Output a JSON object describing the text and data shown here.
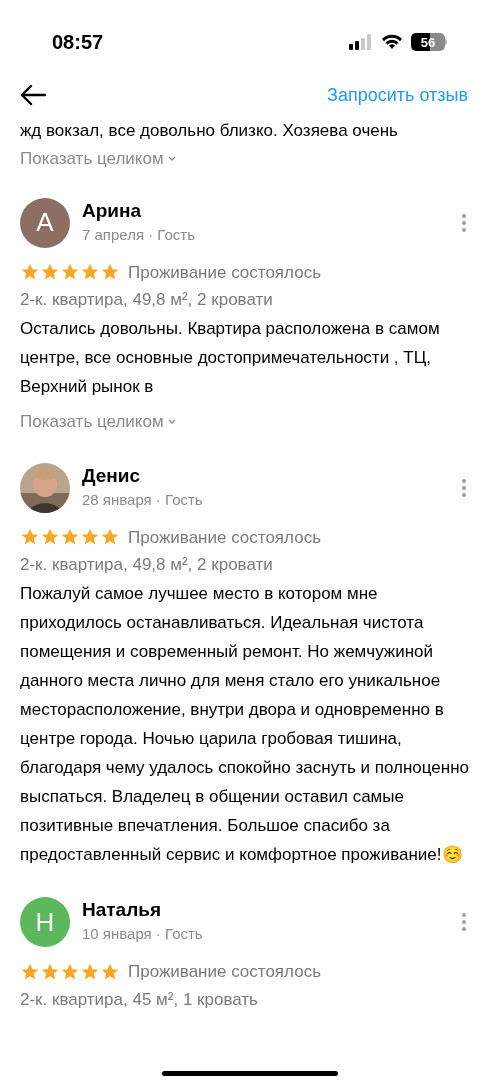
{
  "status_bar": {
    "time": "08:57",
    "battery": "56"
  },
  "header": {
    "action": "Запросить отзыв"
  },
  "previous_review": {
    "text_tail": "жд вокзал, все довольно близко. Хозяева очень",
    "expand": "Показать целиком"
  },
  "reviews": [
    {
      "avatar": {
        "kind": "letter",
        "letter": "А",
        "color": "#8d6e63"
      },
      "name": "Арина",
      "meta": "7 апреля · Гость",
      "stars": 5,
      "status": "Проживание состоялось",
      "property": "2-к. квартира, 49,8 м², 2 кровати",
      "text": "Остались довольны. Квартира расположена в самом центре, все основные достопримечательности , ТЦ, Верхний рынок в",
      "expand": "Показать целиком"
    },
    {
      "name": "Денис",
      "meta": "28 января · Гость",
      "stars": 5,
      "status": "Проживание состоялось",
      "property": "2-к. квартира, 49,8 м², 2 кровати",
      "text": "Пожалуй самое лучшее место в котором мне приходилось останавливаться. Идеальная чистота помещения и современный ремонт. Но жемчужиной данного места лично для меня стало его уникальное месторасположение, внутри двора и одновременно в центре города. Ночью царила гробовая тишина, благодаря чему удалось спокойно заснуть и полноценно выспаться. Владелец в общении оставил самые позитивные впечатления. Большое спасибо за предоставленный сервис и комфортное проживание!☺️"
    },
    {
      "avatar": {
        "kind": "letter",
        "letter": "Н",
        "color": "#5cb85c"
      },
      "name": "Наталья",
      "meta": "10 января · Гость",
      "stars": 5,
      "status": "Проживание состоялось",
      "property": "2-к. квартира, 45 м², 1 кровать"
    }
  ]
}
